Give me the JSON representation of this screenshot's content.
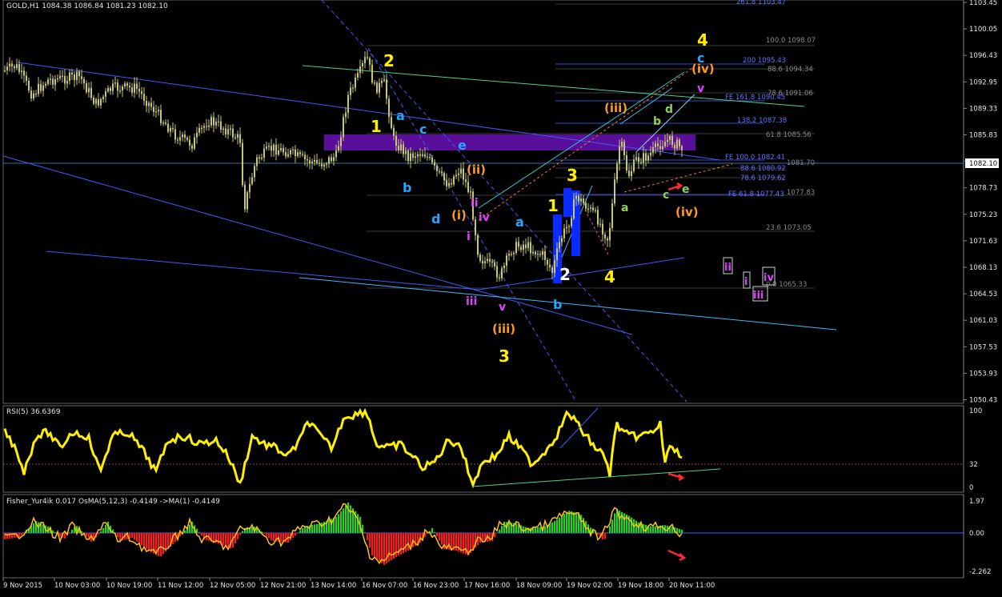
{
  "header": {
    "symbol_line": "GOLD,H1  1084.38 1086.84 1081.23 1082.10"
  },
  "price_scale": {
    "ticks": [
      "1103.45",
      "1100.05",
      "1096.43",
      "1092.95",
      "1089.33",
      "1085.83",
      "1082.10",
      "1078.73",
      "1075.23",
      "1071.63",
      "1068.13",
      "1064.53",
      "1061.03",
      "1057.53",
      "1053.93",
      "1050.43"
    ],
    "current_price": "1082.10"
  },
  "fib_labels": {
    "f2618": "261.8 1103.47",
    "f1000": "100.0 1098.07",
    "f200": "200 1095.43",
    "f886a": "88.6 1094.34",
    "f786a": "78.6 1091.06",
    "fe1618": "FE 161.8 1090.45",
    "f1382": "138.2 1087.38",
    "f618": "61.8 1085.56",
    "fe100": "FE 100.0 1082.41",
    "f500": "1081.70",
    "f886b": "88.6 1080.92",
    "f786b": "78.6 1079.62",
    "fe618": "FE 61.8 1077.43",
    "f1077": "1077.83",
    "f236": "23.6 1073.05",
    "f00": "0.0 1065.33"
  },
  "wave_labels": {
    "yellow": {
      "w4_top": "4",
      "w2": "2",
      "w1": "1",
      "w3_mid": "3",
      "w1_mid": "1",
      "w4_low": "4",
      "w3": "3",
      "w2_low": "2"
    },
    "cyan": {
      "a1": "a",
      "c1": "c",
      "e1": "e",
      "b1": "b",
      "d1": "d",
      "a2": "a",
      "b2": "b",
      "c_top": "c"
    },
    "orange": {
      "ii": "(ii)",
      "i": "(i)",
      "iii": "(iii)",
      "iii_top": "(iii)",
      "iv_top": "(iv)",
      "iv_low": "(iv)"
    },
    "magenta": {
      "ii": "ii",
      "iv": "iv",
      "i": "i",
      "iii": "iii",
      "v": "v",
      "v_top": "v"
    },
    "green": {
      "b": "b",
      "d": "d",
      "a": "a",
      "c": "c",
      "e": "e"
    },
    "boxed": {
      "ii": "ii",
      "i": "i",
      "iii": "iii",
      "iv": "iv"
    }
  },
  "rsi": {
    "label": "RSI(5) 36.6369",
    "ticks": [
      "100",
      "32",
      "0"
    ]
  },
  "fisher": {
    "label": "Fisher_Yur4ik 0.017  OsMA(5,12,3) -0.4149  ->MA(1) -0.4149",
    "ticks": [
      "1.97",
      "0.00",
      "-2.262"
    ]
  },
  "time_axis": [
    "9 Nov 2015",
    "10 Nov 03:00",
    "10 Nov 19:00",
    "11 Nov 12:00",
    "12 Nov 05:00",
    "12 Nov 21:00",
    "13 Nov 14:00",
    "16 Nov 07:00",
    "16 Nov 23:00",
    "17 Nov 16:00",
    "18 Nov 09:00",
    "19 Nov 02:00",
    "19 Nov 18:00",
    "20 Nov 11:00"
  ],
  "colors": {
    "candle": "#c8c86e",
    "yellow": "#ffee00",
    "cyan": "#25a6ff",
    "orange": "#ff9a1f",
    "magenta": "#e040ff",
    "green": "#8fd055",
    "purple_zone": "#5a0f9a",
    "blue_line": "#3c5bff",
    "trend_cyan": "#3fb7ff",
    "osma_green": "#22d41f",
    "osma_red": "#ff1a1a",
    "rsi_yellow": "#ffef00",
    "arrow_red": "#ff2a2a"
  }
}
